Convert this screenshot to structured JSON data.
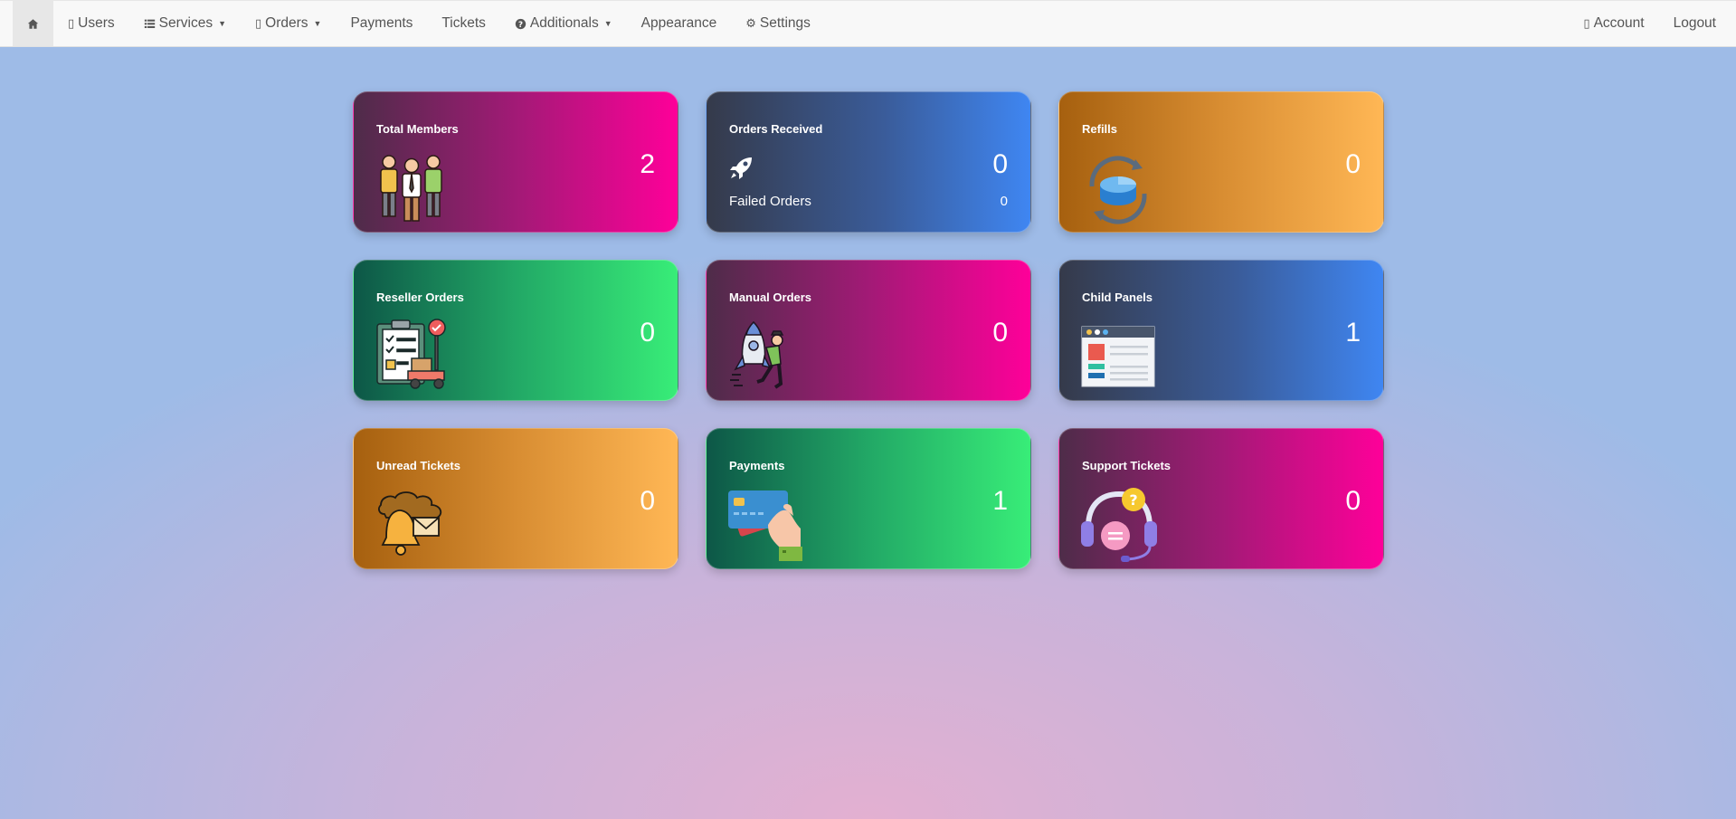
{
  "nav": {
    "home_icon": "home-icon",
    "left": [
      {
        "label": "Users",
        "icon": "user-icon"
      },
      {
        "label": "Services",
        "icon": "list-icon",
        "caret": true
      },
      {
        "label": "Orders",
        "icon": "cart-icon",
        "caret": true
      },
      {
        "label": "Payments"
      },
      {
        "label": "Tickets"
      },
      {
        "label": "Additionals",
        "icon": "question-circle-icon",
        "caret": true
      },
      {
        "label": "Appearance"
      },
      {
        "label": "Settings",
        "icon": "gear-icon"
      }
    ],
    "right": [
      {
        "label": "Account",
        "icon": "user-icon"
      },
      {
        "label": "Logout"
      }
    ]
  },
  "cards": [
    {
      "title": "Total Members",
      "value": "2",
      "icon": "team-members-icon",
      "gradient": "purple-pink"
    },
    {
      "title": "Orders Received",
      "value": "0",
      "icon": "rocket-icon",
      "gradient": "dark-blue",
      "sub_label": "Failed Orders",
      "sub_value": "0"
    },
    {
      "title": "Refills",
      "value": "0",
      "icon": "refill-cycle-icon",
      "gradient": "orange"
    },
    {
      "title": "Reseller Orders",
      "value": "0",
      "icon": "clipboard-delivery-icon",
      "gradient": "green"
    },
    {
      "title": "Manual Orders",
      "value": "0",
      "icon": "rocket-push-icon",
      "gradient": "purple-pink"
    },
    {
      "title": "Child Panels",
      "value": "1",
      "icon": "browser-panel-icon",
      "gradient": "dark-blue"
    },
    {
      "title": "Unread Tickets",
      "value": "0",
      "icon": "bell-mail-icon",
      "gradient": "orange"
    },
    {
      "title": "Payments",
      "value": "1",
      "icon": "credit-card-hand-icon",
      "gradient": "green"
    },
    {
      "title": "Support Tickets",
      "value": "0",
      "icon": "headset-support-icon",
      "gradient": "purple-pink"
    }
  ],
  "colors": {
    "purple_pink": [
      "#4e2c49",
      "#fe0099"
    ],
    "dark_blue": [
      "#353a4a",
      "#3f86f2"
    ],
    "orange": [
      "#a6600f",
      "#ffb755"
    ],
    "green": [
      "#0d5747",
      "#38ed78"
    ]
  }
}
